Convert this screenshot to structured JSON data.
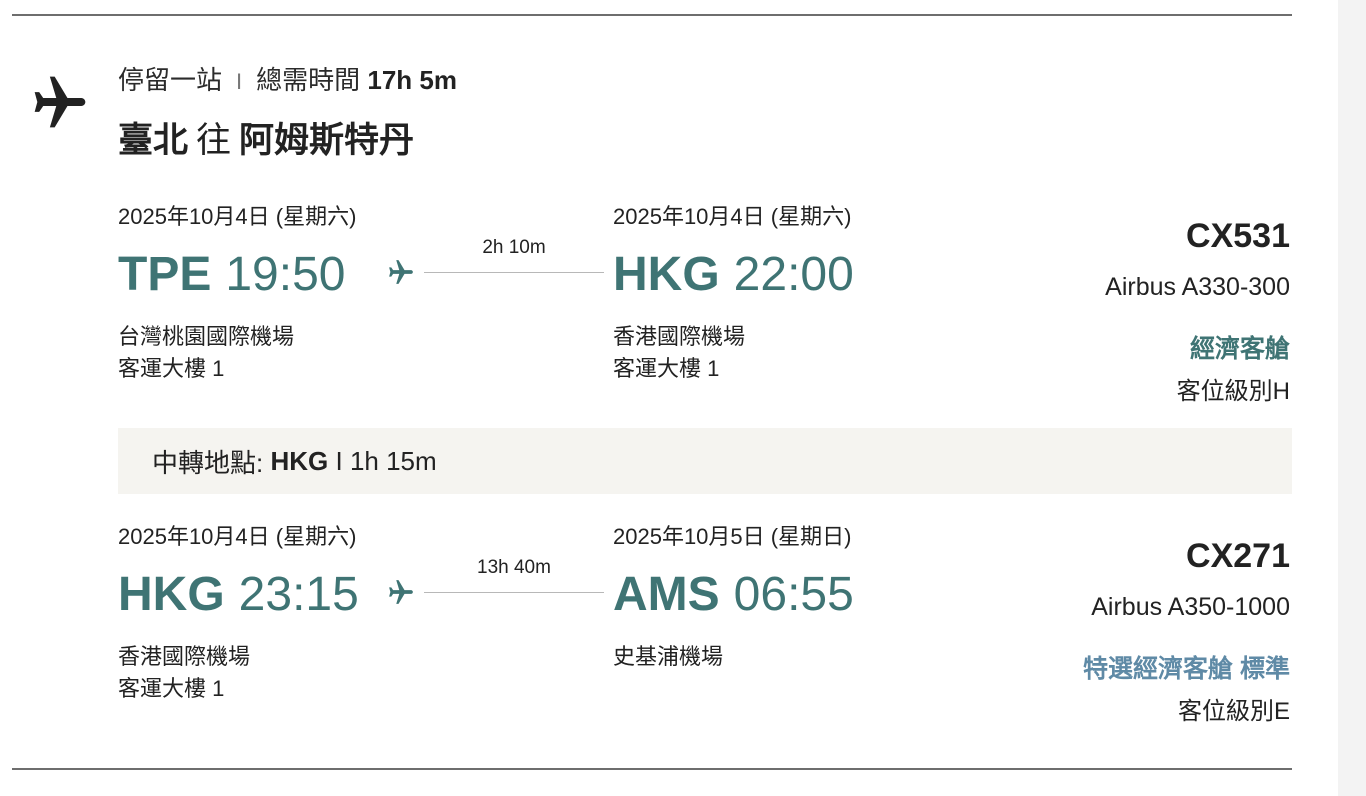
{
  "summary": {
    "stops": "停留一站",
    "separator": "I",
    "total_label": "總需時間",
    "total_duration": "17h 5m",
    "origin": "臺北",
    "to_word": "往",
    "destination": "阿姆斯特丹"
  },
  "segments": [
    {
      "depart": {
        "date": "2025年10月4日 (星期六)",
        "code": "TPE",
        "time": "19:50",
        "airport": "台灣桃園國際機場",
        "terminal": "客運大樓 1"
      },
      "duration": "2h 10m",
      "arrive": {
        "date": "2025年10月4日 (星期六)",
        "code": "HKG",
        "time": "22:00",
        "airport": "香港國際機場",
        "terminal": "客運大樓 1"
      },
      "flight_no": "CX531",
      "aircraft": "Airbus A330-300",
      "cabin": "經濟客艙",
      "cabin_color": "#3f7474",
      "booking_class": "客位級別H"
    },
    {
      "depart": {
        "date": "2025年10月4日 (星期六)",
        "code": "HKG",
        "time": "23:15",
        "airport": "香港國際機場",
        "terminal": "客運大樓 1"
      },
      "duration": "13h 40m",
      "arrive": {
        "date": "2025年10月5日 (星期日)",
        "code": "AMS",
        "time": "06:55",
        "airport": "史基浦機場",
        "terminal": ""
      },
      "flight_no": "CX271",
      "aircraft": "Airbus A350-1000",
      "cabin": "特選經濟客艙 標準",
      "cabin_color": "#5f8aa6",
      "booking_class": "客位級別E"
    }
  ],
  "transit": {
    "label": "中轉地點:",
    "code": "HKG",
    "separator": "I",
    "duration": "1h 15m"
  },
  "colors": {
    "accent": "#3f7474",
    "premium": "#5f8aa6",
    "transit_bg": "#f5f4f0"
  },
  "icons": {
    "header": "airplane-icon",
    "leg": "airplane-small-icon"
  }
}
